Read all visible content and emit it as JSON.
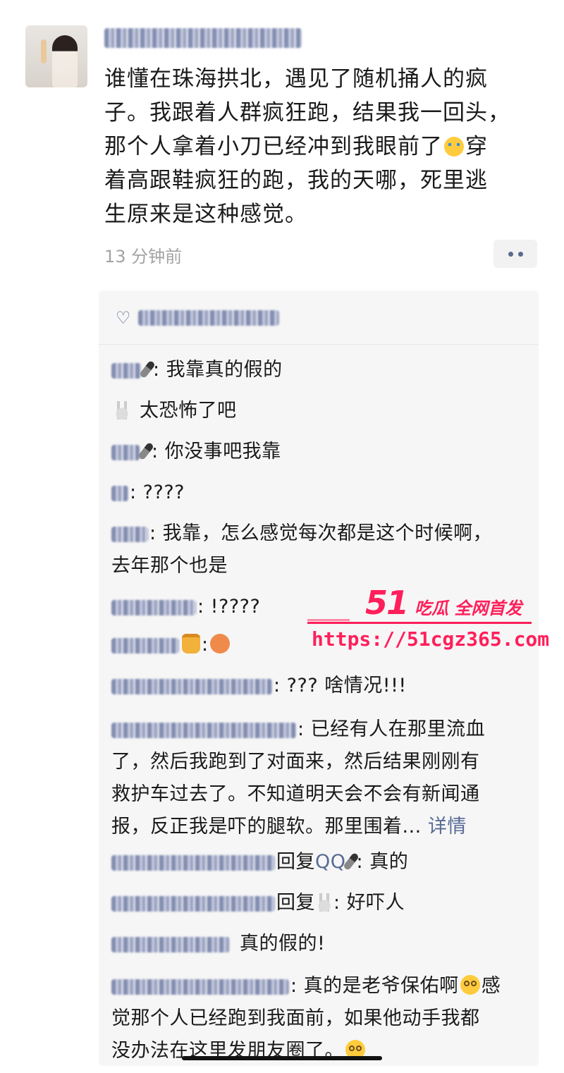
{
  "post": {
    "text": "谁懂在珠海拱北，遇见了随机捅人的疯子。我跟着人群疯狂跑，结果我一回头，那个人拿着小刀已经冲到我眼前了😭穿着高跟鞋疯狂的跑，我的天哪，死里逃生原来是这种感觉。",
    "text_lines": [
      "谁懂在珠海拱北，遇见了随机捅人的疯",
      "子。我跟着人群疯狂跑，结果我一回头，",
      "那个人拿着小刀已经冲到我眼前了",
      "着高跟鞋疯狂的跑，我的天哪，死里逃",
      "生原来是这种感觉。"
    ],
    "text_line3_tail": "穿",
    "time": "13 分钟前",
    "more_icon": "more-dots-icon"
  },
  "likes": {
    "icon": "heart-icon"
  },
  "comments": [
    {
      "text": ": 我靠真的假的"
    },
    {
      "text": "太恐怖了吧"
    },
    {
      "text": ": 你没事吧我靠"
    },
    {
      "text": ": ????"
    },
    {
      "text_lines": [
        ": 我靠，怎么感觉每次都是这个时候啊，",
        "去年那个也是"
      ]
    },
    {
      "text": ": !????"
    },
    {
      "text": ":"
    },
    {
      "text": ": ??? 啥情况!!!"
    },
    {
      "text_lines": [
        ": 已经有人在那里流血",
        "了，然后我跑到了对面来，然后结果刚刚有",
        "救护车过去了。不知道明天会不会有新闻通",
        "报，反正我是吓的腿软。那里围着..."
      ],
      "link": "详情"
    },
    {
      "reply": "回复",
      "target": "QQ",
      "text": ": 真的"
    },
    {
      "reply": "回复",
      "text": ": 好吓人"
    },
    {
      "text": "真的假的!"
    },
    {
      "text_lines": [
        ": 真的是老爷保佑啊",
        "觉那个人已经跑到我面前，如果他动手我都",
        "没办法在这里发朋友圈了。"
      ],
      "line1_tail": "感"
    }
  ],
  "watermark": {
    "brand": "51",
    "slogan": "吃瓜 全网首发",
    "url": "https://51cgz365.com",
    "color": "#ff1f5a"
  }
}
